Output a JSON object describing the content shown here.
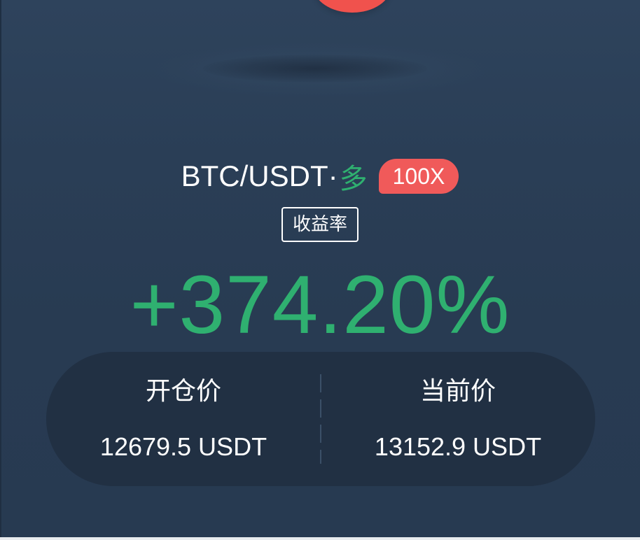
{
  "position": {
    "pair": "BTC/USDT",
    "separator": "·",
    "side": "多",
    "leverage": "100X"
  },
  "metric": {
    "label": "收益率",
    "value": "+374.20%"
  },
  "prices": {
    "open_label": "开仓价",
    "open_value": "12679.5 USDT",
    "current_label": "当前价",
    "current_value": "13152.9 USDT"
  },
  "colors": {
    "background": "#2b3f57",
    "positive": "#2fb070",
    "leverage_badge": "#f05a5a",
    "panel": "#213043"
  }
}
